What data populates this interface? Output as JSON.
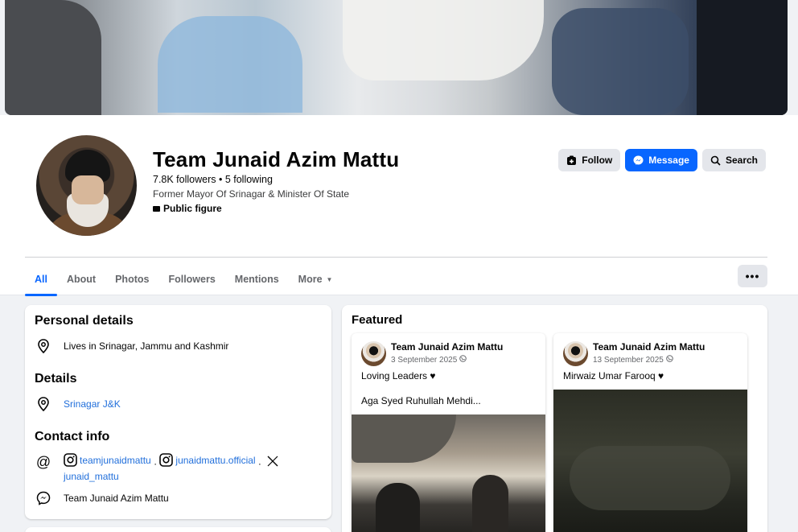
{
  "profile": {
    "name": "Team Junaid Azim Mattu",
    "stats": "7.8K followers • 5 following",
    "bio": "Former Mayor Of Srinagar & Minister Of State",
    "category": "Public figure"
  },
  "actions": {
    "follow": "Follow",
    "message": "Message",
    "search": "Search"
  },
  "tabs": [
    "All",
    "About",
    "Photos",
    "Followers",
    "Mentions",
    "More"
  ],
  "more_menu": "•••",
  "colors": {
    "accent": "#0866ff",
    "link": "#216fdb"
  },
  "personal_details": {
    "title": "Personal details",
    "lives_in": "Lives in Srinagar, Jammu and Kashmir"
  },
  "details": {
    "title": "Details",
    "location": "Srinagar J&K"
  },
  "contact": {
    "title": "Contact info",
    "instagram1": "teamjunaidmattu",
    "sep1": "·",
    "instagram2": "junaidmattu.official",
    "sep2": "·",
    "x_handle": "junaid_mattu",
    "messenger": "Team Junaid Azim Mattu"
  },
  "featured": {
    "title": "Featured",
    "posts": [
      {
        "author": "Team Junaid Azim Mattu",
        "date": "3 September 2025",
        "text": "Loving Leaders ♥",
        "text2": "Aga Syed Ruhullah Mehdi..."
      },
      {
        "author": "Team Junaid Azim Mattu",
        "date": "13 September 2025",
        "text": "Mirwaiz Umar Farooq ♥"
      }
    ]
  }
}
